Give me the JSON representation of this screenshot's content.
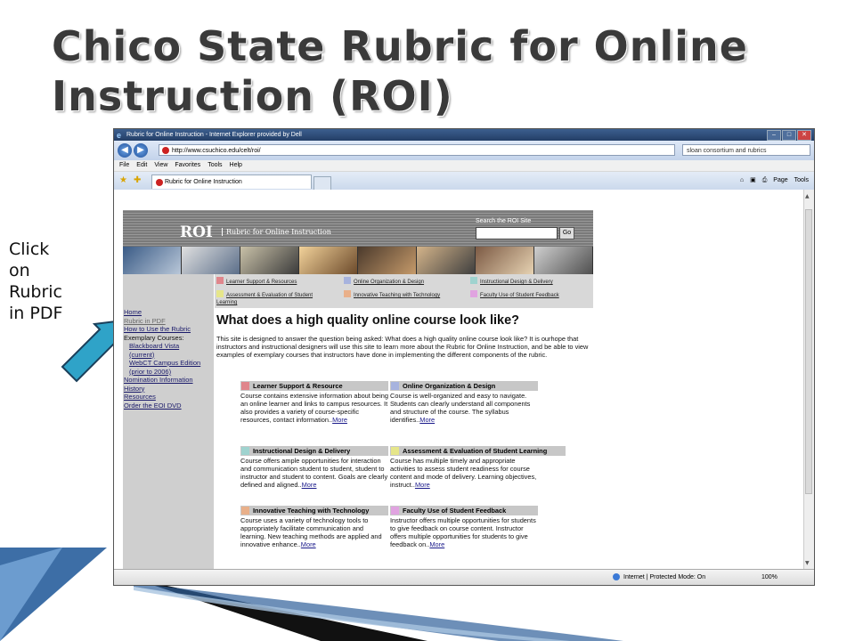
{
  "slide": {
    "title_line1": "Chico State Rubric for Online",
    "title_line2": "Instruction (ROI)",
    "callout": [
      "Click",
      "on",
      "Rubric",
      "in PDF"
    ]
  },
  "browser": {
    "window_title": "Rubric for Online Instruction - Internet Explorer provided by Dell",
    "url": "http://www.csuchico.edu/celt/roi/",
    "search_text": "sloan consortium and rubrics",
    "menu": [
      "File",
      "Edit",
      "View",
      "Favorites",
      "Tools",
      "Help"
    ],
    "tab_title": "Rubric for Online Instruction",
    "commands": [
      "Page",
      "Tools"
    ],
    "status_zone": "Internet | Protected Mode: On",
    "zoom": "100%"
  },
  "site": {
    "logo": "ROI",
    "logo_sub": "Rubric for Online Instruction",
    "search_label": "Search the ROI Site",
    "go_label": "Go",
    "categories": [
      {
        "label": "Learner Support & Resources",
        "color": "#e0868c"
      },
      {
        "label": "Online Organization & Design",
        "color": "#a7b3de"
      },
      {
        "label": "Instructional Design & Delivery",
        "color": "#9fd3cf"
      },
      {
        "label": "Assessment & Evaluation of Student Learning",
        "color": "#e6e68a"
      },
      {
        "label": "Innovative Teaching with Technology",
        "color": "#e9b08a"
      },
      {
        "label": "Faculty Use of Student Feedback",
        "color": "#e0a3e0"
      }
    ],
    "sidebar": [
      "Home",
      "Rubric in PDF",
      "How to Use the Rubric",
      "Exemplary Courses:",
      "Blackboard Vista",
      "(current)",
      "WebCT Campus Edition",
      "(prior to 2006)",
      "Nomination Information",
      "History",
      "Resources",
      "Order the EOI DVD"
    ],
    "heading": "What does a high quality online course look like?",
    "intro": "This site is designed to answer the question being asked: What does a high quality online course look like? It is ourhope that instructors and instructional designers will use this site to learn more about the Rubric for Online Instruction, and be able to view examples of exemplary courses that instructors have done in implementing the different components of the rubric.",
    "more_label": "More",
    "cards": [
      {
        "title": "Learner Support & Resource",
        "text": "Course contains extensive information about being an online learner and links to campus resources. It also provides a variety of course-specific resources, contact information..",
        "color": "#e0868c"
      },
      {
        "title": "Online Organization & Design",
        "text": "Course is well-organized and easy to navigate. Students can clearly understand all components and structure of the course. The syllabus identifies..",
        "color": "#a7b3de"
      },
      {
        "title": "Instructional Design & Delivery",
        "text": "Course offers ample opportunities for interaction and communication student to student, student to instructor and student to content. Goals are clearly defined and aligned..",
        "color": "#9fd3cf"
      },
      {
        "title": "Assessment & Evaluation of Student Learning",
        "text": "Course has multiple timely and appropriate activities to assess student readiness for course content and mode of delivery. Learning objectives, instruct..",
        "color": "#e6e68a"
      },
      {
        "title": "Innovative Teaching with Technology",
        "text": "Course uses a variety of technology tools to appropriately facilitate communication and learning. New teaching methods are applied and innovative enhance..",
        "color": "#e9b08a"
      },
      {
        "title": "Faculty Use of Student Feedback",
        "text": "Instructor offers multiple opportunities for students to give feedback on course content. Instructor offers multiple opportunities for students to give feedback on..",
        "color": "#e0a3e0"
      }
    ]
  },
  "colors": {
    "arrow": "#2fa3c8",
    "title": "#3a3a3a",
    "chrome": "#233e66",
    "sidebar": "#cfcfcf"
  }
}
